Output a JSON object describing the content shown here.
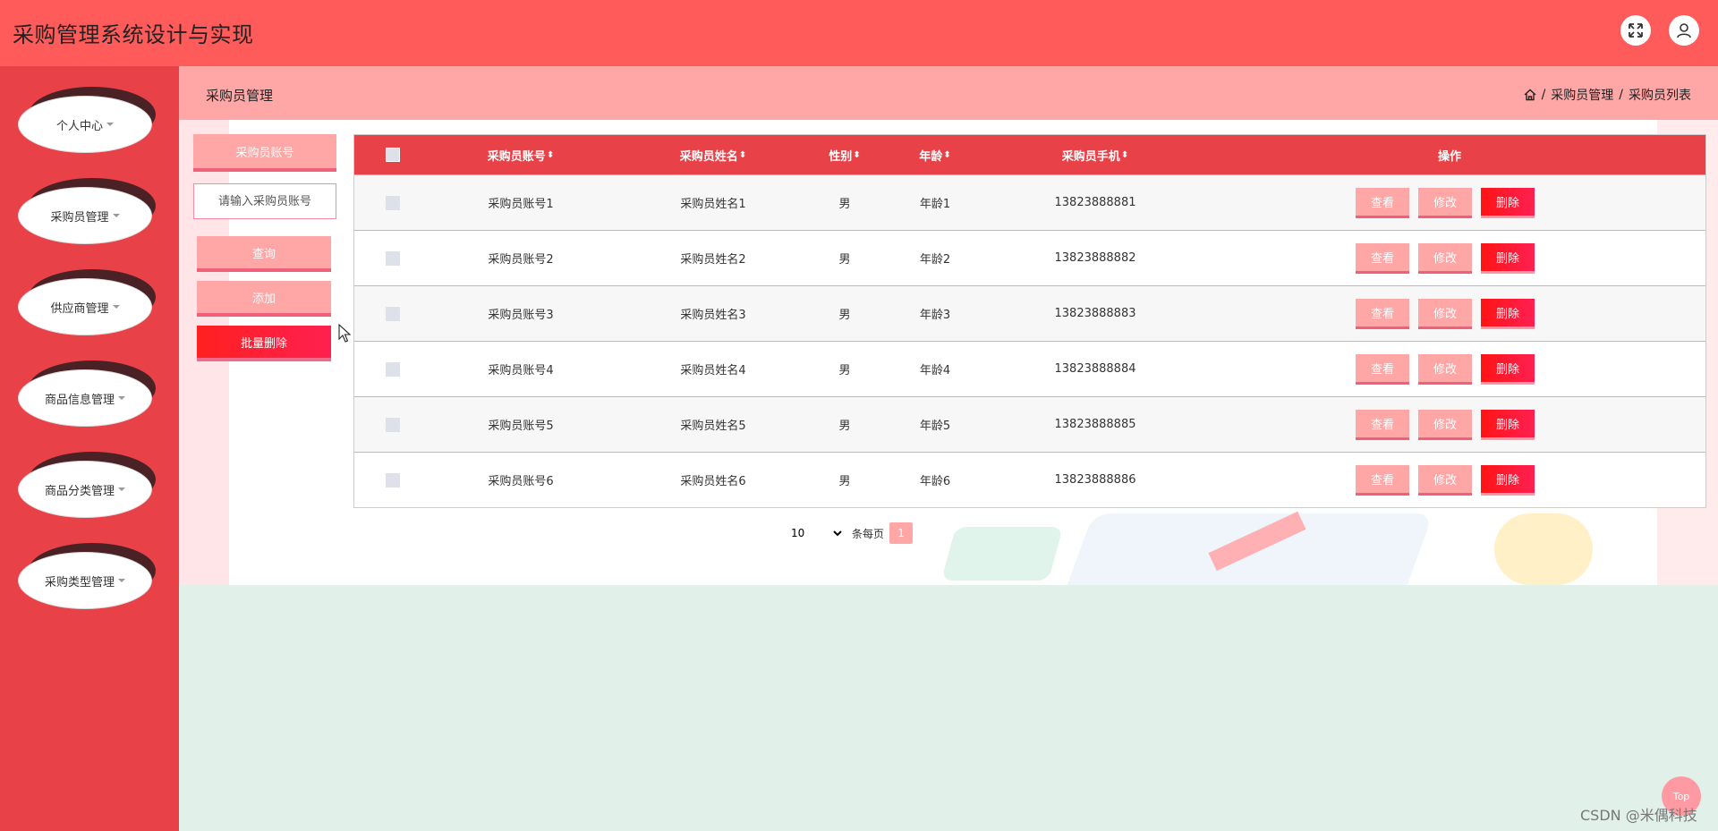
{
  "app": {
    "title": "采购管理系统设计与实现"
  },
  "header": {
    "icons": [
      "fullscreen-icon",
      "user-icon"
    ]
  },
  "sidebar": {
    "items": [
      {
        "label": "个人中心"
      },
      {
        "label": "采购员管理"
      },
      {
        "label": "供应商管理"
      },
      {
        "label": "商品信息管理"
      },
      {
        "label": "商品分类管理"
      },
      {
        "label": "采购类型管理"
      }
    ]
  },
  "breadcrumb": {
    "page_title": "采购员管理",
    "trail": [
      "采购员管理",
      "采购员列表"
    ],
    "separator": "/"
  },
  "search": {
    "label": "采购员账号",
    "placeholder": "请输入采购员账号",
    "query_label": "查询",
    "add_label": "添加",
    "batch_delete_label": "批量删除"
  },
  "table": {
    "headers": {
      "account": "采购员账号",
      "name": "采购员姓名",
      "gender": "性别",
      "age": "年龄",
      "phone": "采购员手机",
      "ops": "操作"
    },
    "sort_glyph": "⬍",
    "actions": {
      "view": "查看",
      "edit": "修改",
      "delete": "删除"
    },
    "rows": [
      {
        "account": "采购员账号1",
        "name": "采购员姓名1",
        "gender": "男",
        "age": "年龄1",
        "phone": "13823888881"
      },
      {
        "account": "采购员账号2",
        "name": "采购员姓名2",
        "gender": "男",
        "age": "年龄2",
        "phone": "13823888882"
      },
      {
        "account": "采购员账号3",
        "name": "采购员姓名3",
        "gender": "男",
        "age": "年龄3",
        "phone": "13823888883"
      },
      {
        "account": "采购员账号4",
        "name": "采购员姓名4",
        "gender": "男",
        "age": "年龄4",
        "phone": "13823888884"
      },
      {
        "account": "采购员账号5",
        "name": "采购员姓名5",
        "gender": "男",
        "age": "年龄5",
        "phone": "13823888885"
      },
      {
        "account": "采购员账号6",
        "name": "采购员姓名6",
        "gender": "男",
        "age": "年龄6",
        "phone": "13823888886"
      }
    ]
  },
  "pagination": {
    "page_size": "10",
    "per_page_label": "条每页",
    "current_page": "1"
  },
  "to_top": {
    "label": "Top"
  },
  "watermark": {
    "text": "CSDN @米偶科技"
  },
  "colors": {
    "topbar": "#ff5b5b",
    "sidebar": "#e94148",
    "breadcrumb_bar": "#ffa6a6",
    "table_header": "#e94148",
    "delete_button": "#ff1414"
  }
}
